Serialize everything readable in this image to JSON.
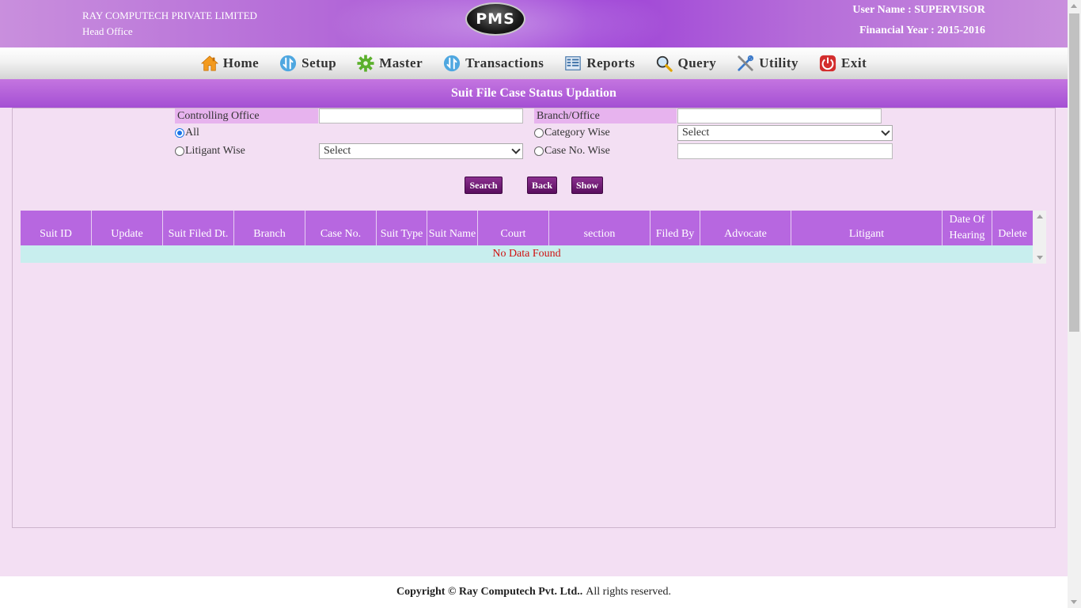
{
  "header": {
    "company": "RAY COMPUTECH PRIVATE LIMITED",
    "office": "Head Office",
    "logo_text": "PMS",
    "user": "User Name : SUPERVISOR",
    "financial_year": "Financial Year : 2015-2016"
  },
  "nav": {
    "items": [
      {
        "label": "Home",
        "icon": "home-icon"
      },
      {
        "label": "Setup",
        "icon": "setup-icon"
      },
      {
        "label": "Master",
        "icon": "gear-icon"
      },
      {
        "label": "Transactions",
        "icon": "transactions-icon"
      },
      {
        "label": "Reports",
        "icon": "reports-icon"
      },
      {
        "label": "Query",
        "icon": "magnifier-icon"
      },
      {
        "label": "Utility",
        "icon": "tools-icon"
      },
      {
        "label": "Exit",
        "icon": "power-icon"
      }
    ]
  },
  "page": {
    "title": "Suit File Case Status Updation"
  },
  "form": {
    "controlling_office_label": "Controlling Office",
    "controlling_office_value": "",
    "branch_office_label": "Branch/Office",
    "branch_office_value": "",
    "radio_all": "All",
    "radio_category": "Category Wise",
    "category_select": "Select",
    "radio_litigant": "Litigant Wise",
    "litigant_select": "Select",
    "radio_caseno": "Case No. Wise",
    "caseno_value": "",
    "selected_radio": "All"
  },
  "buttons": {
    "search": "Search",
    "back": "Back",
    "show": "Show"
  },
  "table": {
    "columns": [
      "Suit ID",
      "Update",
      "Suit Filed Dt.",
      "Branch",
      "Case No.",
      "Suit Type",
      "Suit Name",
      "Court",
      "section",
      "Filed By",
      "Advocate",
      "Litigant",
      "Date Of Hearing",
      "Delete"
    ],
    "empty_message": "No Data Found"
  },
  "footer": {
    "bold": "Copyright © Ray Computech Pvt. Ltd..",
    "normal": "All rights reserved."
  },
  "colors": {
    "header_purple": "#a44fd3",
    "table_head": "#b767e0",
    "empty_row": "#c8eeee",
    "button": "#5a0e5e",
    "background": "#f3dff3"
  }
}
